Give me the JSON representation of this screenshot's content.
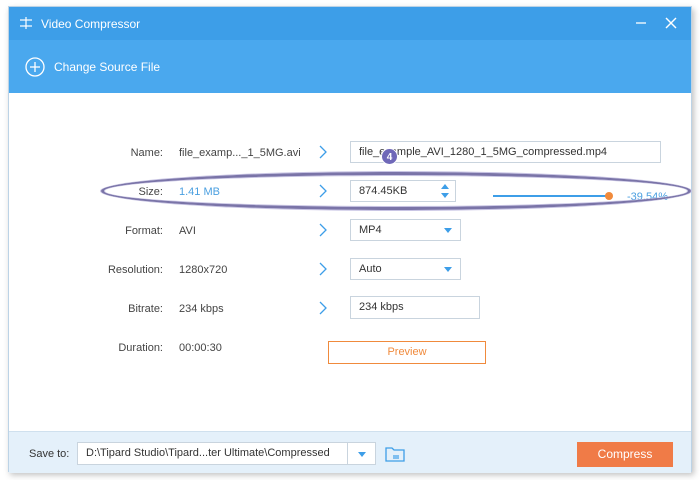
{
  "window": {
    "title": "Video Compressor"
  },
  "toolbar": {
    "change_source_label": "Change Source File"
  },
  "rows": {
    "name": {
      "label": "Name:",
      "source": "file_examp..._1_5MG.avi",
      "output": "file_example_AVI_1280_1_5MG_compressed.mp4"
    },
    "size": {
      "label": "Size:",
      "source": "1.41 MB",
      "output": "874.45KB",
      "percent_label": "-39.54%",
      "slider_fraction": 1.0
    },
    "format": {
      "label": "Format:",
      "source": "AVI",
      "output": "MP4"
    },
    "resolution": {
      "label": "Resolution:",
      "source": "1280x720",
      "output": "Auto"
    },
    "bitrate": {
      "label": "Bitrate:",
      "source": "234 kbps",
      "output": "234 kbps"
    },
    "duration": {
      "label": "Duration:",
      "source": "00:00:30"
    }
  },
  "preview_label": "Preview",
  "annotation": {
    "badge": "4"
  },
  "footer": {
    "save_to_label": "Save to:",
    "save_path": "D:\\Tipard Studio\\Tipard...ter Ultimate\\Compressed",
    "compress_label": "Compress"
  },
  "colors": {
    "accent": "#3d9ee8",
    "orange": "#f08a3c",
    "compress": "#f07b47"
  }
}
